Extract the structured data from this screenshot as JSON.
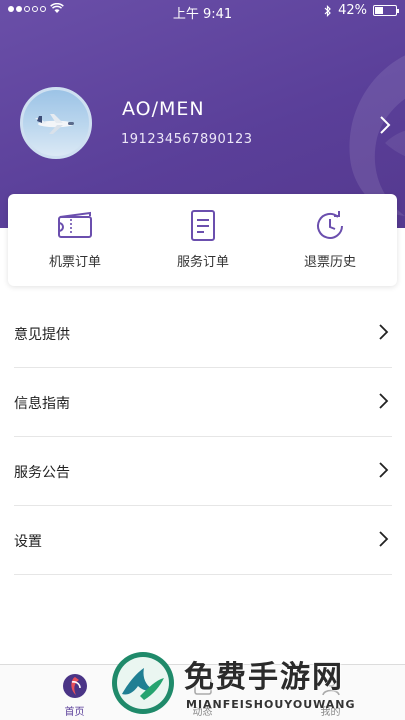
{
  "status_bar": {
    "time": "上午 9:41",
    "battery": "42%",
    "battery_level": 0.42
  },
  "profile": {
    "name": "AO/MEN",
    "phone": "191234567890123"
  },
  "orders": [
    {
      "label": "机票订单",
      "icon": "ticket-icon"
    },
    {
      "label": "服务订单",
      "icon": "document-icon"
    },
    {
      "label": "退票历史",
      "icon": "history-clock-icon"
    }
  ],
  "menu": [
    {
      "label": "意见提供"
    },
    {
      "label": "信息指南"
    },
    {
      "label": "服务公告"
    },
    {
      "label": "设置"
    }
  ],
  "tabbar": [
    {
      "label": "首页",
      "active": true
    },
    {
      "label": "动态",
      "active": false
    },
    {
      "label": "",
      "active": false
    },
    {
      "label": "我的",
      "active": false
    }
  ],
  "watermark": {
    "title": "免费手游网",
    "subtitle": "MIANFEISHOUYOUWANG"
  },
  "colors": {
    "brand_purple": "#5a3f99",
    "icon_purple": "#6b4fae"
  }
}
